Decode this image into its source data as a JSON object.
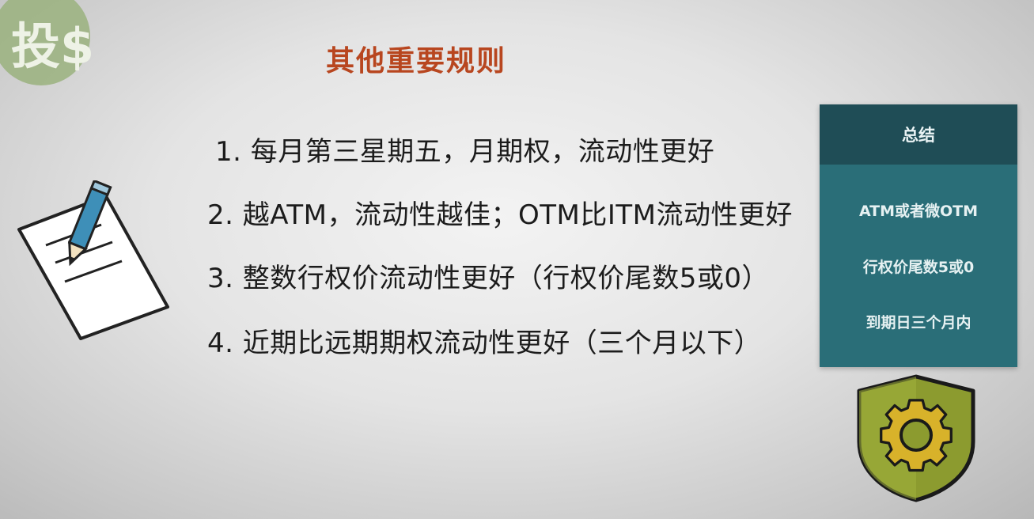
{
  "slide": {
    "title": "其他重要规则",
    "rules": [
      "1. 每月第三星期五，月期权，流动性更好",
      "2. 越ATM，流动性越佳；OTM比ITM流动性更好",
      "3. 整数行权价流动性更好（行权价尾数5或0）",
      "4. 近期比远期期权流动性更好（三个月以下）"
    ],
    "summary": {
      "header": "总结",
      "items": [
        "ATM或者微OTM",
        "行权价尾数5或0",
        "到期日三个月内"
      ]
    }
  },
  "logo": {
    "icon": "logo-icon",
    "text": "投$"
  },
  "icons": {
    "document": "document-pencil-icon",
    "shield": "shield-gear-icon"
  },
  "colors": {
    "title": "#b8461f",
    "panel": "#2a6e78",
    "panel_header": "#1f4d56",
    "shield_fill": "#8c9b2f",
    "gear": "#d8b22a"
  }
}
